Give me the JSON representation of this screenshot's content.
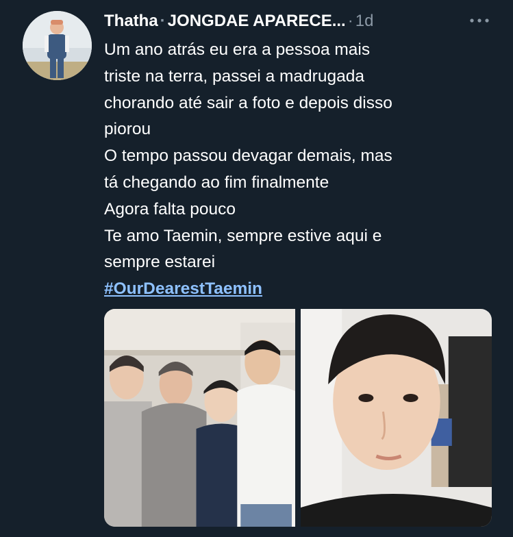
{
  "tweet": {
    "author": {
      "name_prefix": "Thatha",
      "name_suffix": "JONGDAE APARECE...",
      "avatar_icon": "avatar-photo"
    },
    "separator": "·",
    "time_sep": "·",
    "timestamp": "1d",
    "more_icon": "more-horizontal-icon",
    "lines": [
      "Um ano atrás eu era a pessoa mais",
      "triste na terra, passei a madrugada",
      "chorando até sair a foto e depois disso",
      "piorou",
      "O tempo passou devagar demais, mas",
      "tá chegando ao fim finalmente",
      "Agora falta pouco",
      "Te amo Taemin, sempre estive aqui e",
      "sempre estarei"
    ],
    "hashtag": "#OurDearestTaemin",
    "media": [
      {
        "kind": "photo",
        "description": "group-photo"
      },
      {
        "kind": "photo",
        "description": "selfie-photo"
      }
    ]
  },
  "colors": {
    "background": "#15202b",
    "text": "#ffffff",
    "secondary": "#8b98a5",
    "link": "#8ec1ff"
  }
}
